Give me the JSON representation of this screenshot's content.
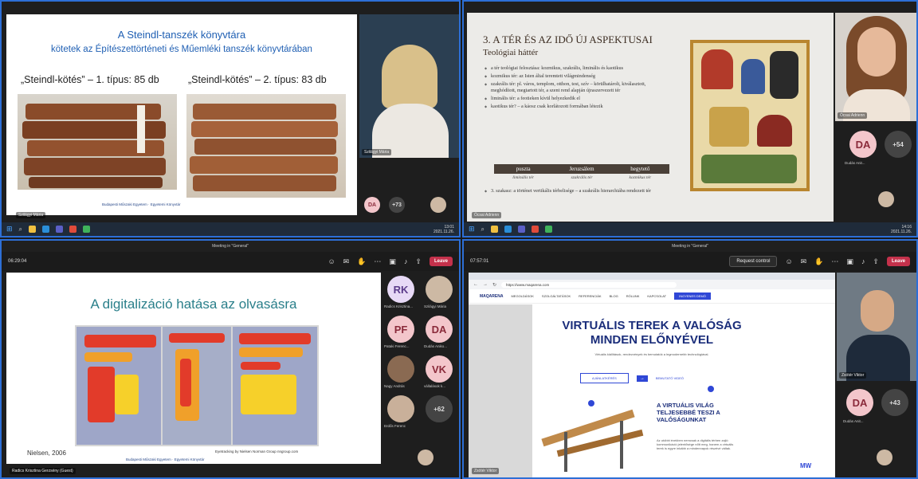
{
  "q1": {
    "slide_title": "A Steindl-tanszék könyvtára",
    "slide_subtitle": "kötetek az Építészettörténeti és Műemléki tanszék könyvtárában",
    "label_left": "„Steindl-kötés” – 1. típus: 85 db",
    "label_right": "„Steindl-kötés” – 2. típus: 83 db",
    "footer_text": "Budapesti Műszaki Egyetem · Egyetemi Könyvtár",
    "presenter_name": "Szilágyi Mária",
    "presenter_label": "Szilágyi Mária",
    "avatar": "DA",
    "more_count": "+73",
    "clock_time": "13:01",
    "clock_date": "2021.11.26."
  },
  "q2": {
    "slide_title": "3. A TÉR ÉS AZ IDŐ ÚJ ASPEKTUSAI",
    "slide_subtitle": "Teológiai háttér",
    "bullets": [
      "a tér teológiai felosztása: kozmikus, szakrális, liminális és kaotikus",
      "kozmikus tér: az Isten által teremtett világmindenség",
      "szakrális tér: pl. város, templom, otthon, test, szív – körülhatárolt, kiválasztott, meghódított, megtartott tér, a szent rend alapján újraszervezett tér",
      "liminális tér: a feotieken kívül helyezkedik el",
      "kaotikus tér? – a káosz csak korlátozott formában létezik"
    ],
    "table_headers": [
      "puszta",
      "Jeruzsálem",
      "hegytető"
    ],
    "table_values": [
      "liminális tér",
      "szakrális tér",
      "kozmikus tér"
    ],
    "bullet_last": "3. szakasz: a történet vertikális térbelisége – a szakrális hierarchiába rendezett tér",
    "presenter_name": "Ócsai Adrienn",
    "presenter_label": "Ócsai Adrienn",
    "avatar": "DA",
    "avatar_label": "Dudás Anit... ",
    "more_count": "+54",
    "clock_time": "14:16",
    "clock_date": "2021.11.26."
  },
  "q3": {
    "window_title": "Meeting in \"General\"",
    "timer": "06:29:04",
    "leave_label": "Leave",
    "slide_title": "A digitalizáció hatása az olvasásra",
    "citation": "Nielsen, 2006",
    "heatmap_caption": "Eyetracking by Nielsen Norman Group   nngroup.com",
    "footer_text": "Budapesti Műszaki Egyetem · Egyetemi Könyvtár",
    "presenter_label": "Radics Krisztina Gerzsény (Guest)",
    "participants": [
      {
        "initials": "RK",
        "name": "Radics Krisztina..."
      },
      {
        "initials": "",
        "name": "Szilágyi Mária"
      },
      {
        "initials": "PF",
        "name": "Pataki Ferenc..."
      },
      {
        "initials": "DA",
        "name": "Dudás Aniko..."
      },
      {
        "initials": "",
        "name": "Nagy András"
      },
      {
        "initials": "VK",
        "name": "vállalások k..."
      },
      {
        "initials": "",
        "name": "Erdős Ferenc"
      },
      {
        "initials": "+62",
        "name": ""
      }
    ]
  },
  "q4": {
    "window_title": "Meeting in \"General\"",
    "timer": "07:57:01",
    "request_label": "Request control",
    "leave_label": "Leave",
    "url": "https://www.maqarena.com",
    "brand": "MAQARENA",
    "nav": [
      "MEGOLDÁSOK",
      "SZOLGÁLTATÁSOK",
      "REFERENCIÁK",
      "BLOG",
      "RÓLUNK",
      "KAPCSOLAT"
    ],
    "nav_button": "INGYENES DEMÓ",
    "hero_title_1": "VIRTUÁLIS TEREK A VALÓSÁG",
    "hero_title_2": "MINDEN ELŐNYÉVEL",
    "hero_sub": "Virtuális kiállítások, rendezvények és bemutatók a legmodernebb technológiával.",
    "cta_1": "AJÁNLATKÉRÉS",
    "cta_2": "BEMUTATÓ VIDEÓ",
    "section_title": "A VIRTUÁLIS VILÁG TELJESEBBÉ TESZI A VALÓSÁGUNKAT",
    "section_body": "Az utóbbi években nemcsak a digitális térben zajló kommunikáció jelentősége nőtt meg, hanem a virtuális terek is egyre inkább a mindennapok részévé váltak.",
    "presenter_name": "Zsótér Viktor",
    "presenter_label": "Zsótér Viktor",
    "avatar": "DA",
    "avatar_label": "Dudás Anit...",
    "more_count": "+43"
  },
  "colors": {
    "teams_border": "#2d6fd6",
    "leave": "#c4314b",
    "q1_title": "#1f5fb3",
    "q2_title": "#3c2d22",
    "q3_title": "#2a7f8a",
    "q4_title": "#1a2d7a"
  }
}
